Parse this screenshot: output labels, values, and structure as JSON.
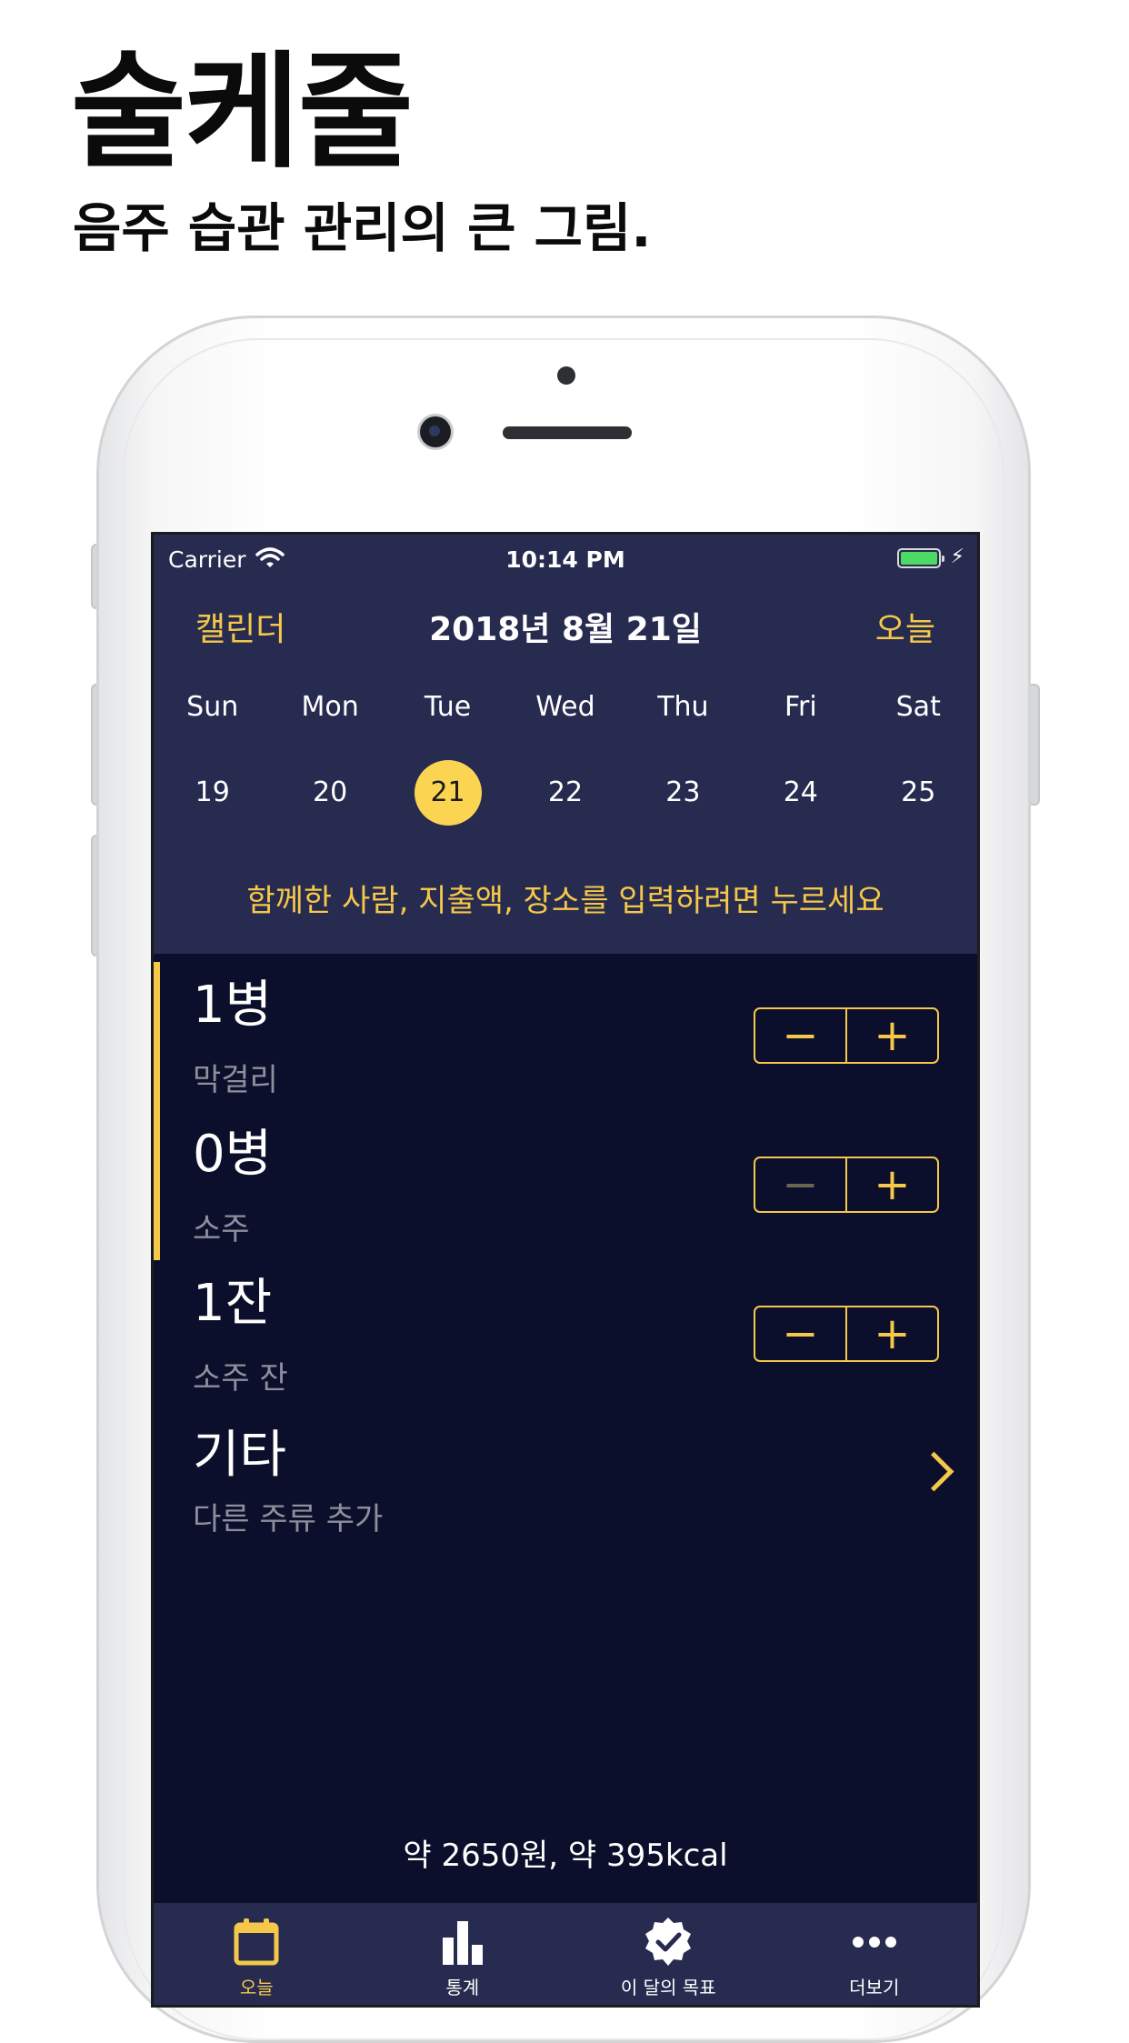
{
  "promo": {
    "title": "술케줄",
    "subtitle": "음주 습관 관리의 큰 그림."
  },
  "status_bar": {
    "carrier": "Carrier",
    "time": "10:14 PM",
    "battery_level": 1.0
  },
  "nav": {
    "left": "캘린더",
    "title": "2018년 8월 21일",
    "right": "오늘"
  },
  "week": {
    "days": [
      "Sun",
      "Mon",
      "Tue",
      "Wed",
      "Thu",
      "Fri",
      "Sat"
    ],
    "dates": [
      "19",
      "20",
      "21",
      "22",
      "23",
      "24",
      "25"
    ],
    "selected": "21"
  },
  "hint": "함께한 사람, 지출액, 장소를 입력하려면 누르세요",
  "drinks": [
    {
      "amount": "1병",
      "name": "막걸리",
      "minus": "−",
      "plus": "+"
    },
    {
      "amount": "0병",
      "name": "소주",
      "minus": "−",
      "plus": "+"
    },
    {
      "amount": "1잔",
      "name": "소주 잔",
      "minus": "−",
      "plus": "+"
    }
  ],
  "other": {
    "title": "기타",
    "subtitle": "다른 주류 추가"
  },
  "summary": "약 2650원, 약 395kcal",
  "tabs": [
    {
      "label": "오늘",
      "icon": "calendar-icon"
    },
    {
      "label": "통계",
      "icon": "bar-chart-icon"
    },
    {
      "label": "이 달의 목표",
      "icon": "check-badge-icon"
    },
    {
      "label": "더보기",
      "icon": "more-icon"
    }
  ],
  "colors": {
    "accent": "#f5c84a",
    "header_bg": "#272b4f",
    "body_bg": "#0c0f2b"
  }
}
